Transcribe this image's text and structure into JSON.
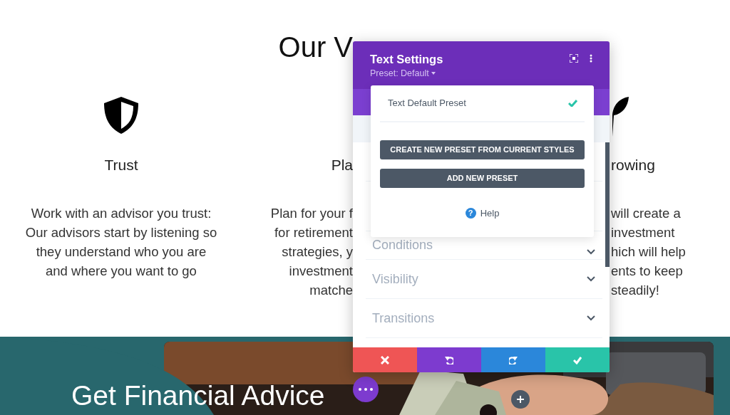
{
  "page": {
    "heading": "Our V",
    "values": [
      {
        "kind": "shield",
        "title": "Trust",
        "lines": [
          "Work with an advisor you trust:",
          "Our advisors start by listening so",
          "they understand who you are",
          "and where you want to go"
        ]
      },
      {
        "kind": "none",
        "title": "Pla",
        "lines": [
          "Plan for your f",
          "for retirement",
          "strategies, y",
          "investment",
          "matche"
        ]
      },
      {
        "kind": "leaf",
        "title": "rowing",
        "lines": [
          "will create a",
          "investment",
          "hich will help",
          "ents to keep",
          "steadily!"
        ]
      }
    ]
  },
  "banner": {
    "title": "Get Financial Advice"
  },
  "modal": {
    "title": "Text Settings",
    "preset": "Preset: Default",
    "sections": [
      {
        "label": "Conditions"
      },
      {
        "label": "Visibility"
      },
      {
        "label": "Transitions"
      }
    ],
    "footer": [
      {
        "kind": "cancel"
      },
      {
        "kind": "undo"
      },
      {
        "kind": "redo"
      },
      {
        "kind": "save"
      }
    ]
  },
  "preset_menu": {
    "items": [
      {
        "label": "Text Default Preset",
        "selected": true
      }
    ],
    "buttons": [
      "CREATE NEW PRESET FROM CURRENT STYLES",
      "ADD NEW PRESET"
    ],
    "help": {
      "glyph": "?",
      "label": "Help"
    }
  }
}
